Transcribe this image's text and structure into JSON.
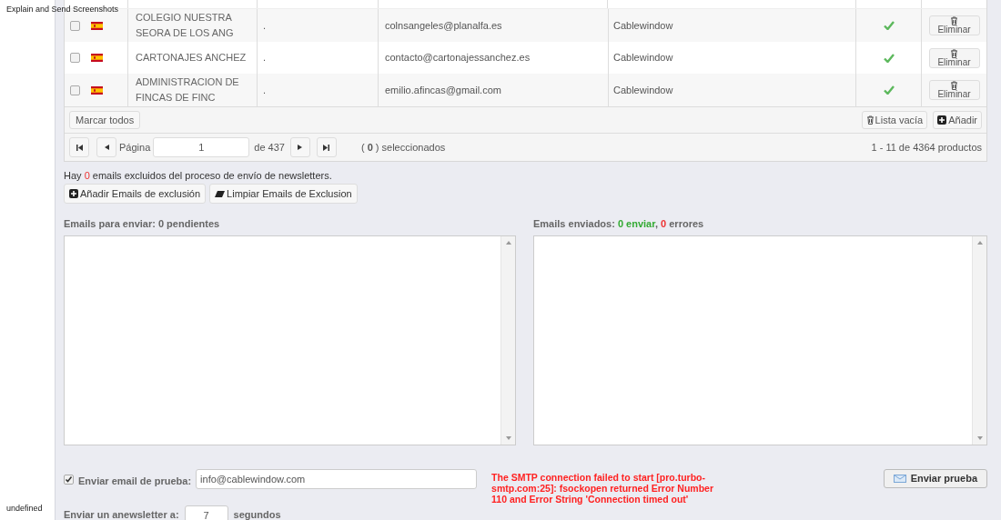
{
  "side_labels": [
    "Explain and Send Screenshots",
    "undefined"
  ],
  "table": {
    "rows": [
      {
        "checked": false,
        "name": "COLEGIO NUESTRA SEORA DE LOS ANG",
        "column_3": ".",
        "email": "colnsangeles@planalfa.es",
        "company": "Cablewindow",
        "active": true,
        "action": "Eliminar"
      },
      {
        "checked": false,
        "name": "CARTONAJES ANCHEZ",
        "column_3": ".",
        "email": "contacto@cartonajessanchez.es",
        "company": "Cablewindow",
        "active": true,
        "action": "Eliminar"
      },
      {
        "checked": false,
        "name": "ADMINISTRACION DE FINCAS DE FINC",
        "column_3": ".",
        "email": "emilio.afincas@gmail.com",
        "company": "Cablewindow",
        "active": true,
        "action": "Eliminar"
      }
    ],
    "mark_all": "Marcar todos",
    "empty_list": "Lista vacía",
    "add": "Añadir",
    "pager": {
      "page_label": "Página",
      "page": "1",
      "of": "de 437",
      "selected": "( **0** ) seleccionados",
      "range": "1 - 11 de 4364 productos"
    }
  },
  "exclusion": {
    "text_before": "Hay ",
    "count": "0",
    "text_after": " emails excluidos del proceso de envío de newsletters.",
    "add_button": "Añadir Emails de exclusión",
    "clear_button": "Limpiar Emails de Exclusion"
  },
  "pending_label": "Emails para enviar: 0 pendientes",
  "sent_label": {
    "before": "Emails enviados: ",
    "sent": "0 enviar",
    "middle": ", ",
    "errors": "0",
    "after": " errores"
  },
  "test": {
    "checked": true,
    "label": "Enviar email de prueba:",
    "value": "info@cablewindow.com",
    "error": "The SMTP connection failed to start [pro.turbo-smtp.com:25]: fsockopen returned Error Number 110 and Error String 'Connection timed out'",
    "button": "Enviar prueba"
  },
  "interval": {
    "label": "Enviar un anewsletter a:",
    "value": "7",
    "unit": "segundos"
  }
}
